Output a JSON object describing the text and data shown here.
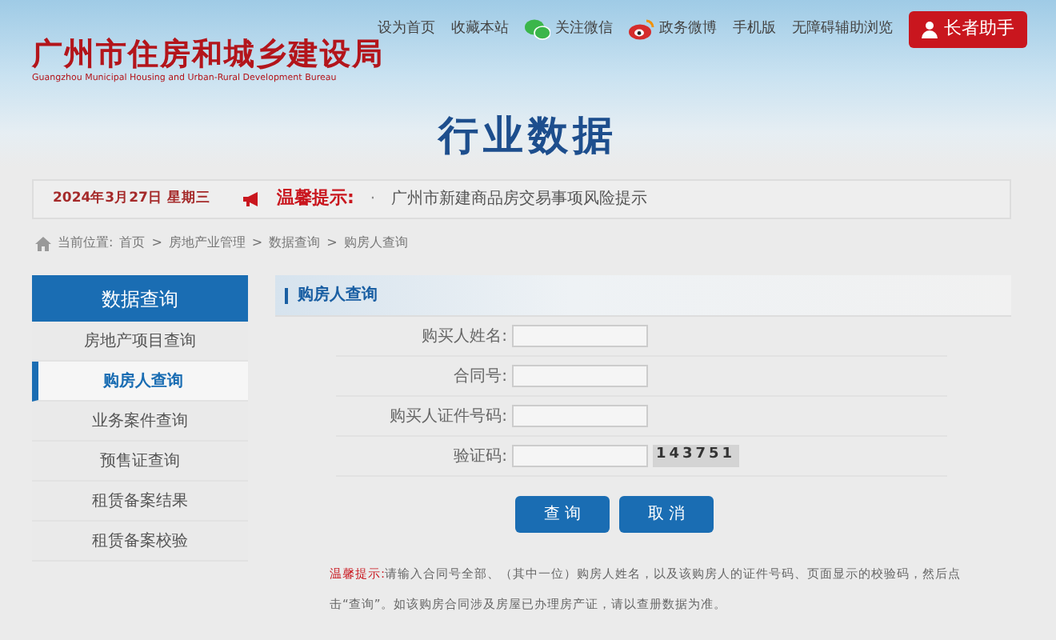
{
  "top_links": [
    {
      "kind": "text",
      "label": "设为首页"
    },
    {
      "kind": "text",
      "label": "收藏本站"
    },
    {
      "kind": "wechat",
      "label": "关注微信"
    },
    {
      "kind": "weibo",
      "label": "政务微博"
    },
    {
      "kind": "text",
      "label": "手机版"
    },
    {
      "kind": "text",
      "label": "无障碍辅助浏览"
    },
    {
      "kind": "elder",
      "label": "长者助手"
    }
  ],
  "logo": {
    "title": "广州市住房和城乡建设局",
    "subtitle": "Guangzhou Municipal Housing and Urban-Rural Development Bureau"
  },
  "page_title": "行业数据",
  "notice": {
    "date": "2024年3月27日 星期三",
    "label": "温馨提示:",
    "bullet": "·",
    "item": "广州市新建商品房交易事项风险提示"
  },
  "breadcrumb": {
    "label": "当前位置:",
    "separator": ">",
    "items": [
      "首页",
      "房地产业管理",
      "数据查询",
      "购房人查询"
    ]
  },
  "sidebar": {
    "title": "数据查询",
    "items": [
      {
        "label": "房地产项目查询",
        "selected": false
      },
      {
        "label": "购房人查询",
        "selected": true
      },
      {
        "label": "业务案件查询",
        "selected": false
      },
      {
        "label": "预售证查询",
        "selected": false
      },
      {
        "label": "租赁备案结果",
        "selected": false
      },
      {
        "label": "租赁备案校验",
        "selected": false
      }
    ]
  },
  "panel": {
    "title": "购房人查询",
    "fields": [
      {
        "kind": "text",
        "label": "购买人姓名:"
      },
      {
        "kind": "text",
        "label": "合同号:"
      },
      {
        "kind": "text",
        "label": "购买人证件号码:"
      },
      {
        "kind": "captcha",
        "label": "验证码:",
        "captcha": "143751"
      }
    ],
    "buttons": [
      "查 询",
      "取 消"
    ],
    "tip": {
      "label": "温馨提示:",
      "text": "请输入合同号全部、（其中一位）购房人姓名，以及该购房人的证件号码、页面显示的校验码，然后点击“查询”。如该购房合同涉及房屋已办理房产证，请以查册数据为准。"
    }
  }
}
